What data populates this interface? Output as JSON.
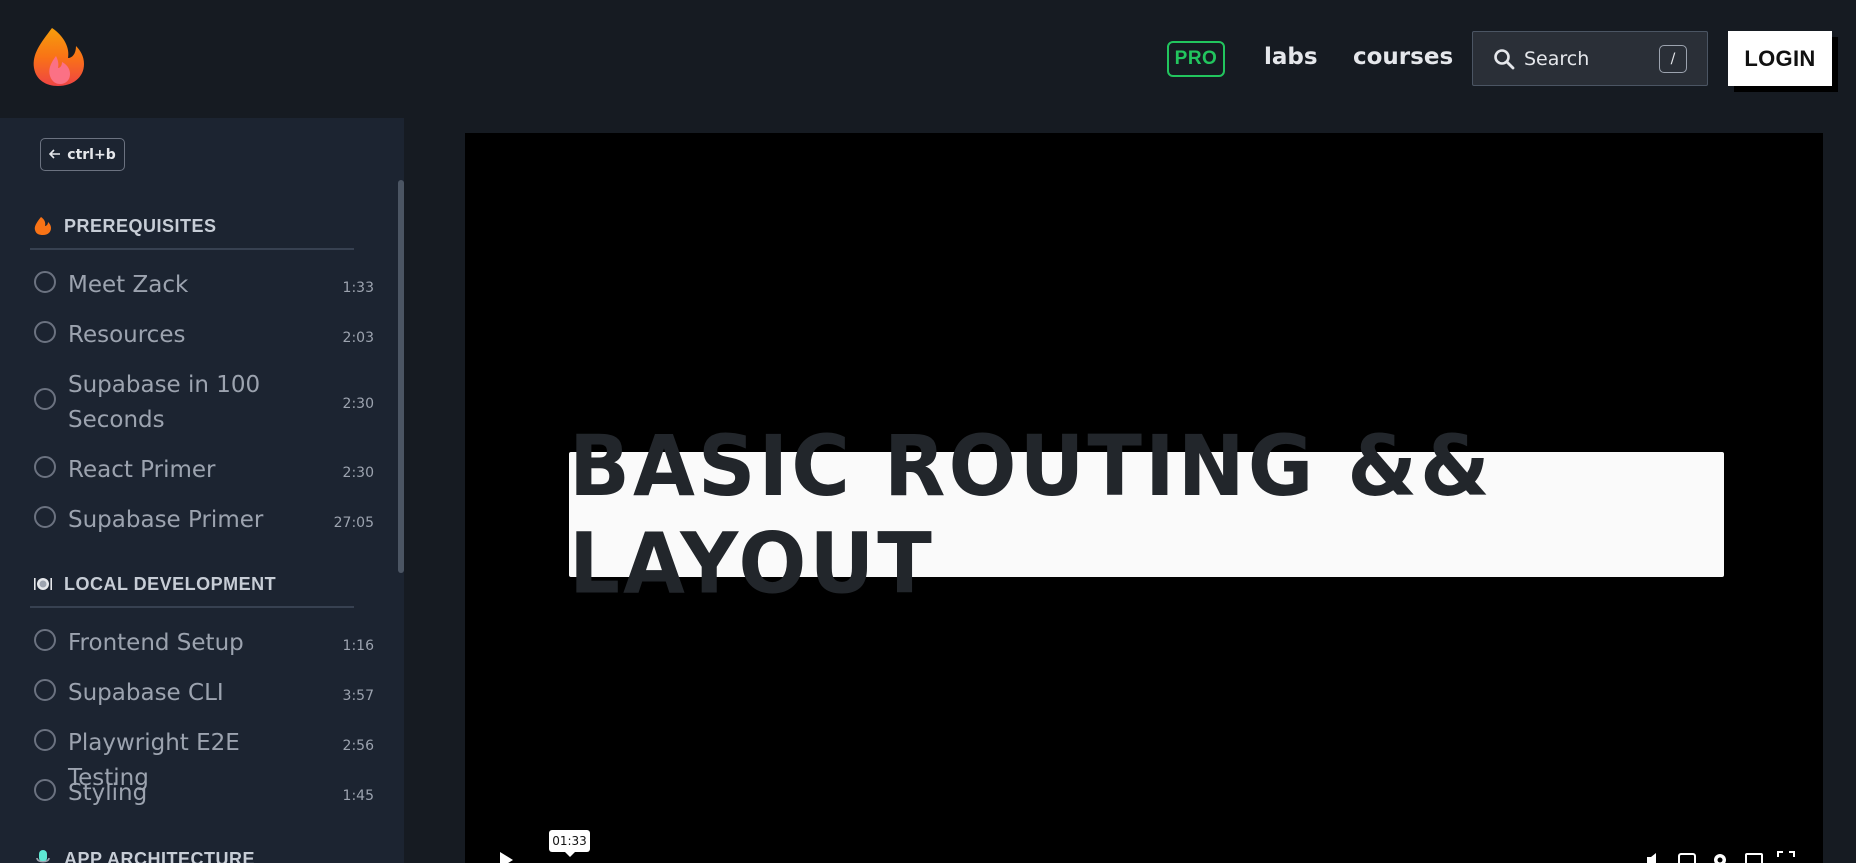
{
  "header": {
    "pro_label": "PRO",
    "nav": {
      "labs": "labs",
      "courses": "courses"
    },
    "search": {
      "label": "Search",
      "shortcut": "/"
    },
    "login_label": "LOGIN"
  },
  "sidebar": {
    "toggle_label": "ctrl+b",
    "sections": [
      {
        "title": "PREREQUISITES",
        "icon": "fire-icon",
        "lessons": [
          {
            "title": "Meet Zack",
            "duration": "1:33"
          },
          {
            "title": "Resources",
            "duration": "2:03"
          },
          {
            "title": "Supabase in 100 Seconds",
            "duration": "2:30"
          },
          {
            "title": "React Primer",
            "duration": "2:30"
          },
          {
            "title": "Supabase Primer",
            "duration": "27:05"
          }
        ]
      },
      {
        "title": "LOCAL DEVELOPMENT",
        "icon": "plate-icon",
        "lessons": [
          {
            "title": "Frontend Setup",
            "duration": "1:16"
          },
          {
            "title": "Supabase CLI",
            "duration": "3:57"
          },
          {
            "title": "Playwright E2E Testing",
            "duration": "2:56"
          },
          {
            "title": "Styling",
            "duration": "1:45"
          }
        ]
      },
      {
        "title": "APP ARCHITECTURE",
        "icon": "microphone-icon",
        "lessons": []
      }
    ]
  },
  "video": {
    "banner_text": "BASIC ROUTING && LAYOUT",
    "tooltip_time": "01:33"
  },
  "colors": {
    "accent_green": "#22c55e",
    "background": "#161b22",
    "sidebar_bg": "#1c2431"
  }
}
